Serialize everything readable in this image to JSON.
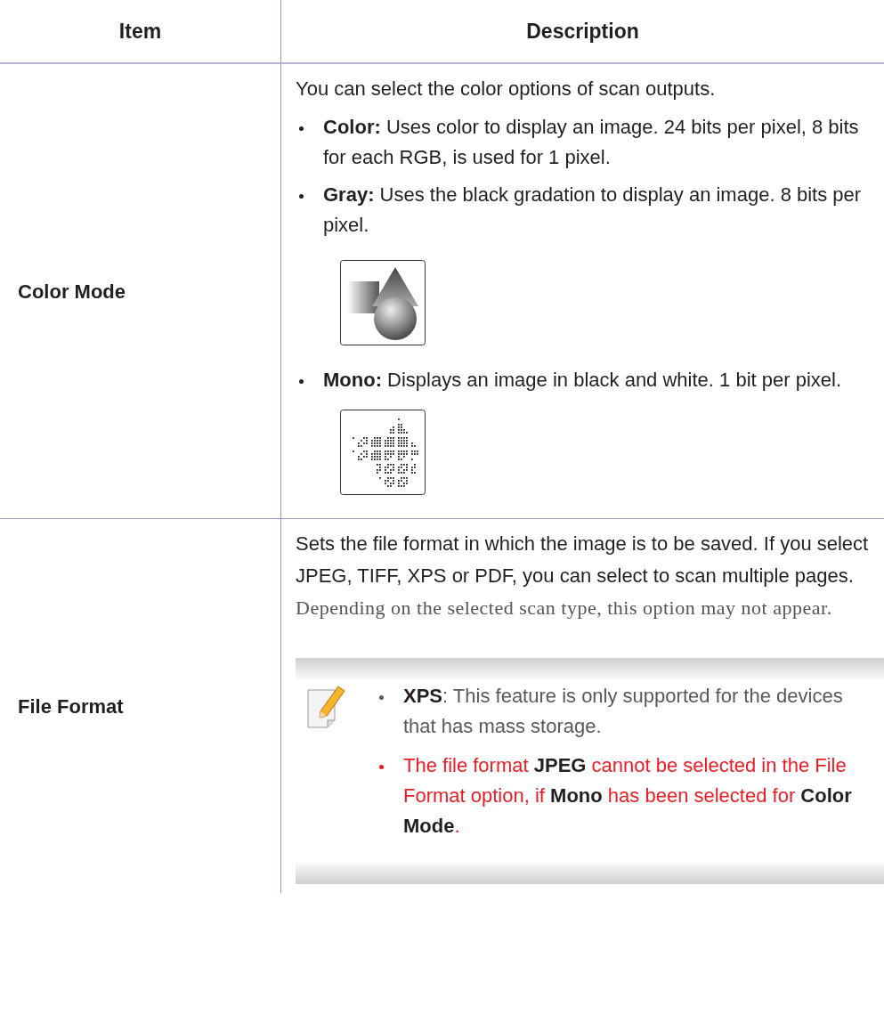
{
  "table": {
    "columns": [
      "Item",
      "Description"
    ],
    "rows": [
      {
        "item": "Color Mode",
        "content": [
          {
            "kind": "paragraph",
            "text": "You can select the color options of scan outputs."
          },
          {
            "kind": "bullet",
            "text": "**Color:** Uses color to display an image. 24 bits per pixel, 8 bits for each RGB, is used for 1 pixel."
          },
          {
            "kind": "bullet",
            "text": "**Gray:** Uses the black gradation to display an image. 8 bits per pixel."
          },
          {
            "kind": "shaded_figure"
          },
          {
            "kind": "bullet",
            "text": "**Mono:**  Displays an image in black and white. 1 bit per pixel."
          },
          {
            "kind": "dithered_figure"
          }
        ]
      },
      {
        "item": "File Format",
        "content": [
          {
            "kind": "paragraph",
            "text": "Sets the file format in which the image is to be saved. If you select JPEG, TIFF, XPS or PDF, you can select to scan multiple pages.",
            "extra": "Depending on the selected scan type, this option may not appear."
          },
          {
            "kind": "note",
            "items": [
              {
                "text": "**XPS**: This feature is only supported for the devices that has mass storage.",
                "color": "#58595b"
              },
              {
                "text": "The file format **JPEG** cannot be selected in the File Format option, if **Mono** has been selected for **Color Mode**.",
                "color": "#ed1c24"
              }
            ]
          }
        ]
      }
    ]
  }
}
